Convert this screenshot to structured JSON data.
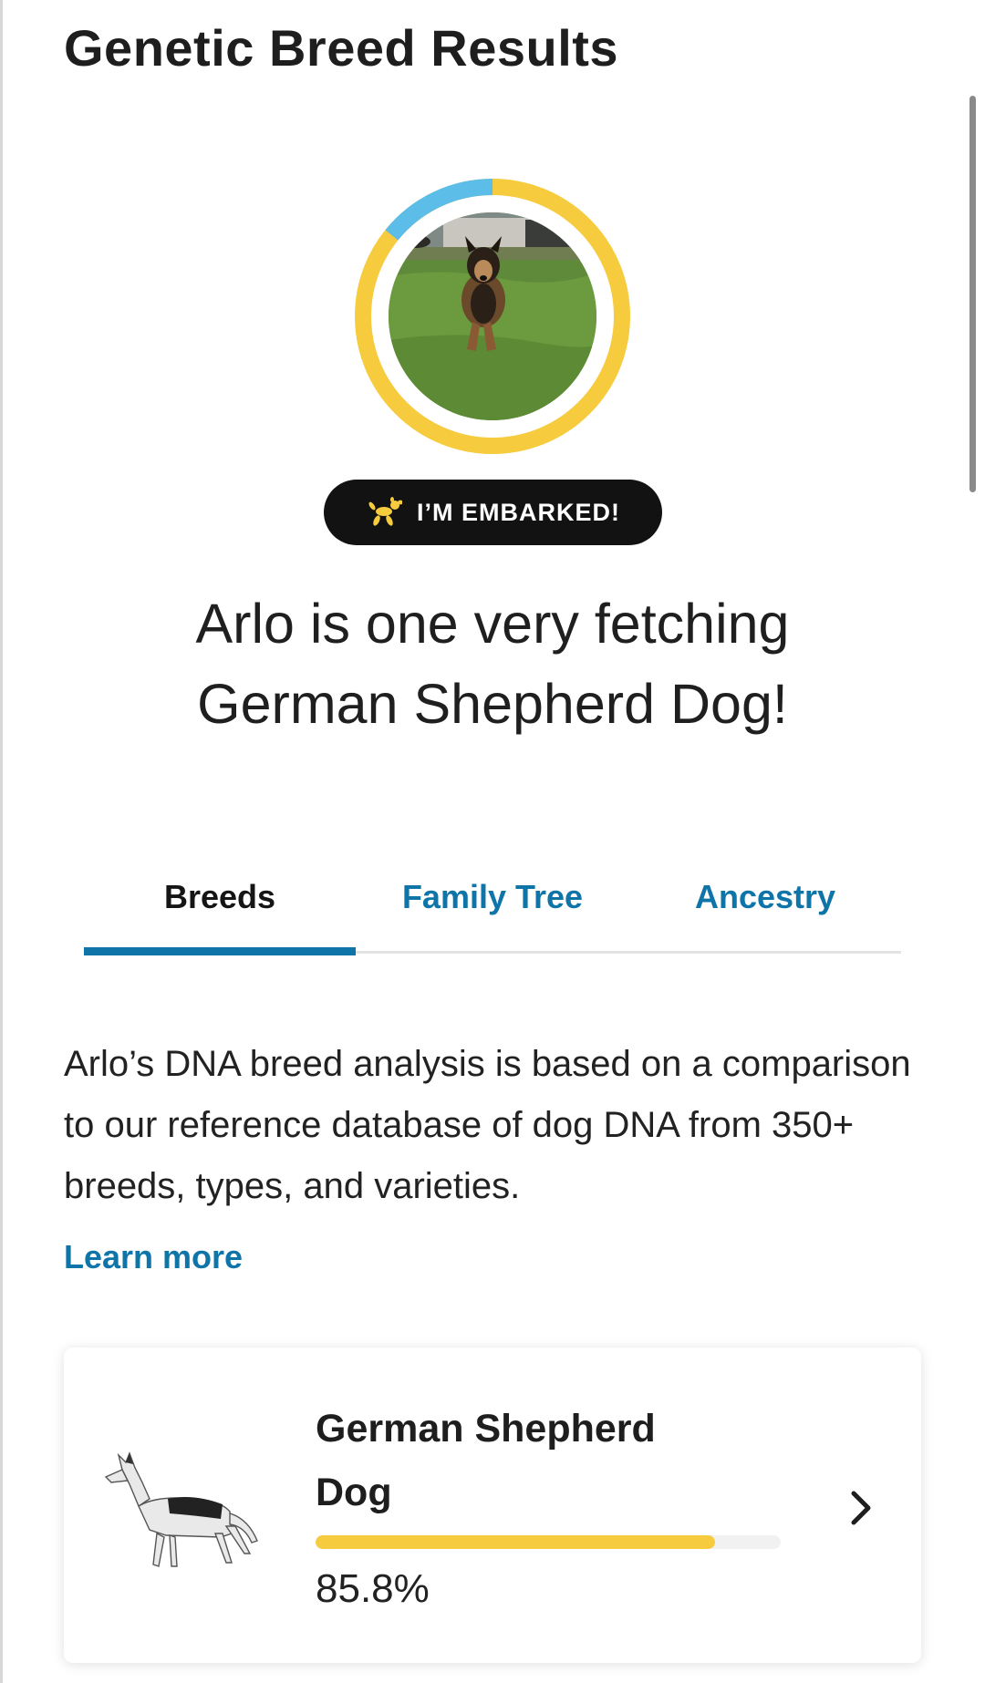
{
  "header": {
    "title": "Genetic Breed Results"
  },
  "avatar": {
    "ring_colors": {
      "primary": "#f7cb3e",
      "secondary": "#5bbde8",
      "background": "#ffffff"
    },
    "ring_primary_fraction": 0.858
  },
  "badge": {
    "label": "I’M EMBARKED!",
    "icon": "balloon-dog-icon",
    "icon_color": "#f7cb3e",
    "background": "#121212"
  },
  "headline": {
    "line1": "Arlo is one very fetching",
    "line2": "German Shepherd Dog!"
  },
  "tabs": [
    {
      "label": "Breeds",
      "active": true
    },
    {
      "label": "Family Tree",
      "active": false
    },
    {
      "label": "Ancestry",
      "active": false
    }
  ],
  "intro": {
    "text": "Arlo’s DNA breed analysis is based on a comparison to our reference database of dog DNA from 350+ breeds, types, and varieties.",
    "learn_more": "Learn more"
  },
  "breed_results": [
    {
      "name": "German Shepherd Dog",
      "percent_label": "85.8%",
      "percent": 85.8,
      "bar_color": "#f7cb3e",
      "icon": "chevron-right-icon"
    }
  ],
  "colors": {
    "accent": "#0f75a8",
    "text": "#1f1f1f"
  }
}
